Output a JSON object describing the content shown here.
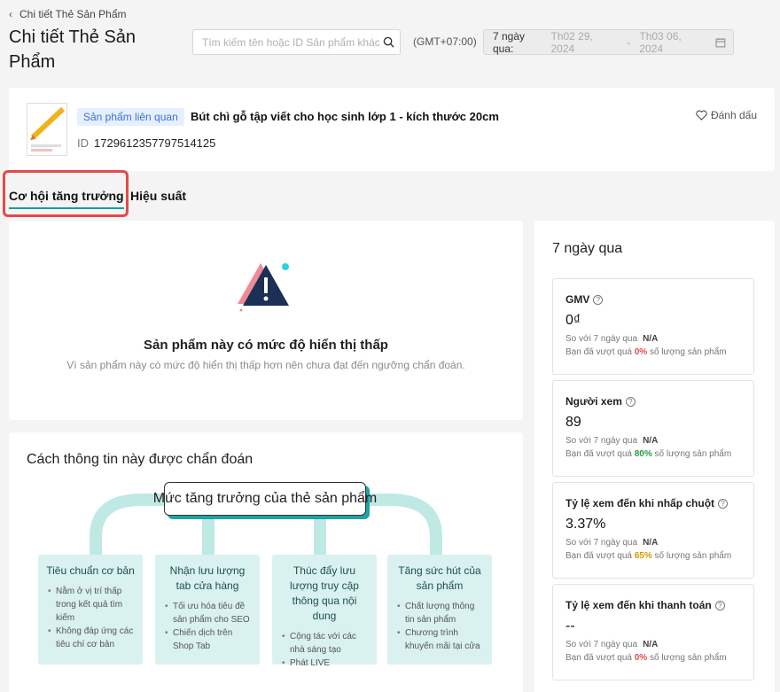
{
  "header": {
    "back_label": "Chi tiết Thẻ Sản Phẩm",
    "page_title": "Chi tiết Thẻ Sản Phẩm",
    "search_placeholder": "Tìm kiếm tên hoặc ID Sản phẩm khác",
    "timezone": "(GMT+07:00)",
    "date_label": "7 ngày qua:",
    "date_start": "Th02 29, 2024",
    "date_sep": "-",
    "date_end": "Th03 06, 2024"
  },
  "product": {
    "tag": "Sản phẩm liên quan",
    "name": "Bút chì gỗ tập viết cho học sinh lớp 1 - kích thước 20cm",
    "id_label": "ID",
    "id": "1729612357797514125",
    "bookmark_label": "Đánh dấu"
  },
  "tabs": [
    {
      "label": "Cơ hội tăng trưởng",
      "active": true
    },
    {
      "label": "Hiệu suất",
      "active": false
    }
  ],
  "warning": {
    "title": "Sản phẩm này có mức độ hiển thị thấp",
    "subtitle": "Vì sản phẩm này có mức độ hiển thị thấp hơn nên chưa đạt đến ngưỡng chẩn đoán."
  },
  "diagnosis": {
    "title": "Cách thông tin này được chẩn đoán",
    "center": "Mức tăng trưởng của thẻ sản phẩm",
    "columns": [
      {
        "title": "Tiêu chuẩn cơ bản",
        "items": [
          "Nằm ở vị trí thấp trong kết quả tìm kiếm",
          "Không đáp ứng các tiêu chí cơ bản"
        ]
      },
      {
        "title": "Nhận lưu lượng tab cửa hàng",
        "items": [
          "Tối ưu hóa tiêu đề sản phẩm cho SEO",
          "Chiến dịch trên Shop Tab"
        ]
      },
      {
        "title": "Thúc đẩy lưu lượng truy cập thông qua nội dung",
        "items": [
          "Cộng tác với các nhà sáng tạo",
          "Phát LIVE"
        ]
      },
      {
        "title": "Tăng sức hút của sản phẩm",
        "items": [
          "Chất lượng thông tin sản phẩm",
          "Chương trình khuyến mãi tại cửa"
        ]
      }
    ]
  },
  "side": {
    "title": "7 ngày qua",
    "compare_label": "So với 7 ngày qua",
    "metrics": [
      {
        "name": "GMV",
        "value": "0₫",
        "compare": "N/A",
        "pct_prefix": "Bạn đã vượt quá",
        "pct": "0%",
        "pct_suffix": "số lượng sản phẩm",
        "pct_color": "#e5484d"
      },
      {
        "name": "Người xem",
        "value": "89",
        "compare": "N/A",
        "pct_prefix": "Bạn đã vượt quá",
        "pct": "80%",
        "pct_suffix": "số lượng sản phẩm",
        "pct_color": "#2a9d4a"
      },
      {
        "name": "Tỷ lệ xem đến khi nhấp chuột",
        "value": "3.37%",
        "compare": "N/A",
        "pct_prefix": "Bạn đã vượt quá",
        "pct": "65%",
        "pct_suffix": "số lượng sản phẩm",
        "pct_color": "#d49a00"
      },
      {
        "name": "Tỷ lệ xem đến khi thanh toán",
        "value": "--",
        "compare": "N/A",
        "pct_prefix": "Bạn đã vượt quá",
        "pct": "0%",
        "pct_suffix": "số lượng sản phẩm",
        "pct_color": "#e5484d"
      }
    ]
  },
  "colors": {
    "accent": "#1b9b9b",
    "highlight": "#e34a4a",
    "tag_bg": "#e6efff"
  }
}
